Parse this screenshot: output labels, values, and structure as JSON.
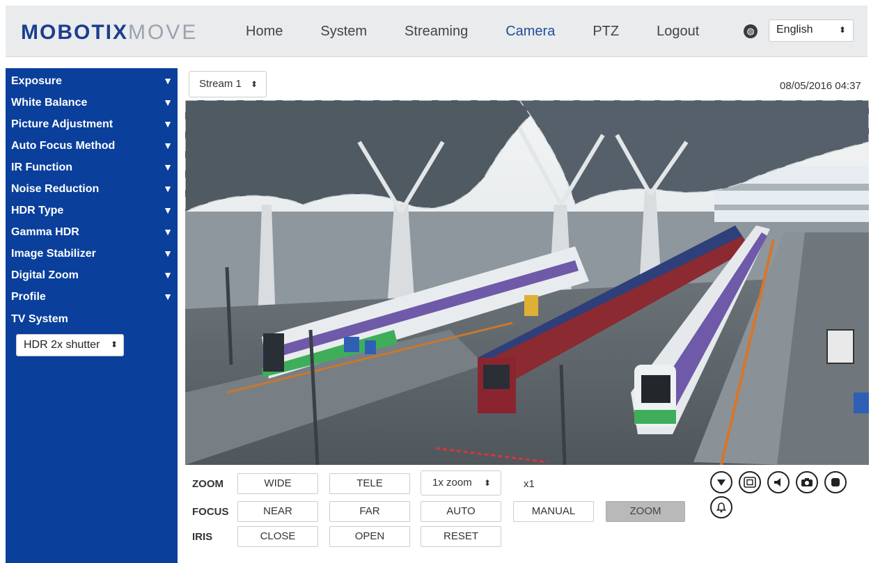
{
  "header": {
    "logo_primary": "MOBOTIX",
    "logo_secondary": "MOVE",
    "nav": [
      {
        "label": "Home"
      },
      {
        "label": "System"
      },
      {
        "label": "Streaming"
      },
      {
        "label": "Camera",
        "active": true
      },
      {
        "label": "PTZ"
      },
      {
        "label": "Logout"
      }
    ],
    "language": "English"
  },
  "sidebar": {
    "items": [
      {
        "label": "Exposure"
      },
      {
        "label": "White Balance"
      },
      {
        "label": "Picture Adjustment"
      },
      {
        "label": "Auto Focus Method"
      },
      {
        "label": "IR Function"
      },
      {
        "label": "Noise Reduction"
      },
      {
        "label": "HDR Type"
      },
      {
        "label": "Gamma HDR"
      },
      {
        "label": "Image Stabilizer"
      },
      {
        "label": "Digital Zoom"
      },
      {
        "label": "Profile"
      },
      {
        "label": "TV System"
      }
    ],
    "hdr_select": "HDR 2x shutter",
    "expand_glyph": "▼",
    "select_caret": "⬍"
  },
  "main": {
    "stream_select": "Stream 1",
    "timestamp": "08/05/2016 04:37",
    "controls": {
      "zoom_label": "ZOOM",
      "focus_label": "FOCUS",
      "iris_label": "IRIS",
      "wide": "WIDE",
      "tele": "TELE",
      "zoom_select": "1x zoom",
      "zoom_value": "x1",
      "near": "NEAR",
      "far": "FAR",
      "auto": "AUTO",
      "manual": "MANUAL",
      "zoom_button": "ZOOM",
      "close": "CLOSE",
      "open": "OPEN",
      "reset": "RESET"
    },
    "icons": [
      "chevron-down-icon",
      "fullscreen-icon",
      "speaker-icon",
      "camera-icon",
      "record-stop-icon",
      "alarm-bell-icon"
    ]
  },
  "colors": {
    "brand_blue": "#1c3e8e",
    "sidebar_blue": "#0a3f9c",
    "nav_active": "#1f4e9a",
    "header_bg": "#e9ebed"
  }
}
